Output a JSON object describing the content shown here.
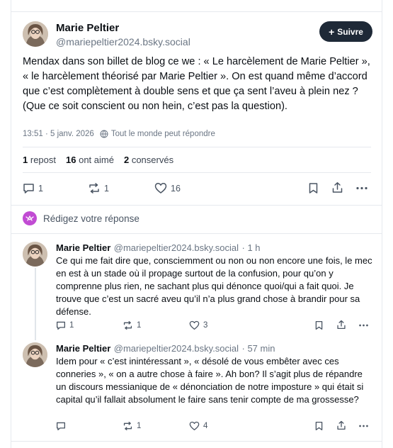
{
  "post": {
    "author_name": "Marie Peltier",
    "author_handle": "@mariepeltier2024.bsky.social",
    "follow_label": "Suivre",
    "text": "Mendax dans son billet de blog ce we : « Le harcèlement de Marie Peltier », « le harcèlement théorisé par Marie Peltier ». On est quand même d’accord que c’est complètement à double sens et que ça sent l’aveu à plein nez ? (Que ce soit conscient ou non hein, c’est pas la question).",
    "timestamp": "13:51 · 5 janv. 2026",
    "audience": "Tout le monde peut répondre",
    "stats": {
      "repost_count": "1",
      "repost_label": "repost",
      "like_count": "16",
      "like_label": "ont aimé",
      "saved_count": "2",
      "saved_label": "conservés"
    },
    "actions": {
      "reply_count": "1",
      "repost_count": "1",
      "like_count": "16"
    }
  },
  "composer": {
    "placeholder": "Rédigez votre réponse"
  },
  "replies": [
    {
      "author_name": "Marie Peltier",
      "author_handle": "@mariepeltier2024.bsky.social",
      "time": "· 1 h",
      "text": "Ce qui me fait dire que, consciemment ou non ou non encore une fois, le mec en est à un stade où il propage surtout de la confusion, pour qu’on y comprenne plus rien, ne sachant plus qui dénonce quoi/qui a fait quoi. Je trouve que c’est un sacré aveu qu’il n’a plus grand chose à brandir pour sa défense.",
      "reply_count": "1",
      "repost_count": "1",
      "like_count": "3"
    },
    {
      "author_name": "Marie Peltier",
      "author_handle": "@mariepeltier2024.bsky.social",
      "time": "· 57 min",
      "text": "Idem pour « c’est inintéressant », « désolé de vous embêter avec ces conneries », « on a autre chose à faire ». Ah bon? Il s’agit plus de répandre un discours messianique de « dénonciation de notre imposture » qui était si capital qu’il fallait absolument le faire sans tenir compte de ma grossesse?",
      "reply_count": "",
      "repost_count": "1",
      "like_count": "4"
    }
  ],
  "colors": {
    "accent_pink": "#c14bd3",
    "follow_bg": "#1e2937",
    "muted": "#6b7684"
  }
}
